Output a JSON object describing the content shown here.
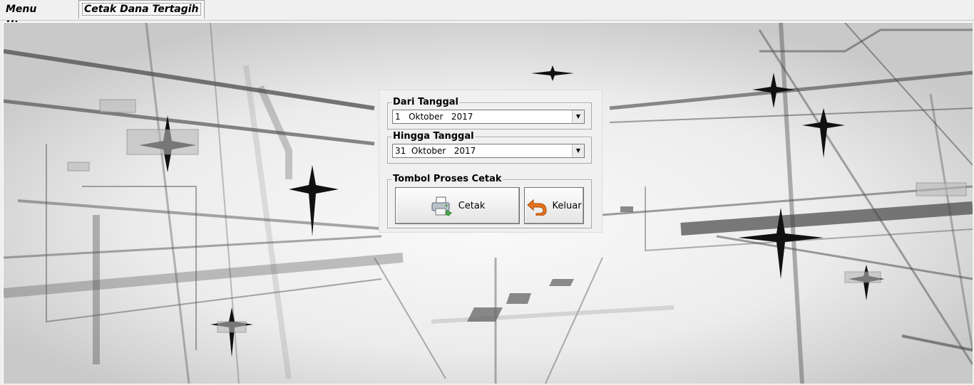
{
  "tabs": [
    {
      "label": "Menu Utama",
      "active": false
    },
    {
      "label": "Cetak Dana Tertagih",
      "active": true
    }
  ],
  "form": {
    "dari_tanggal": {
      "legend": "Dari Tanggal",
      "value": "1   Oktober   2017"
    },
    "hingga_tanggal": {
      "legend": "Hingga Tanggal",
      "value": "31  Oktober   2017"
    },
    "tombol": {
      "legend": "Tombol Proses Cetak",
      "cetak_label": "Cetak",
      "keluar_label": "Keluar"
    }
  },
  "icons": {
    "dropdown": "chevron-down-icon",
    "cetak": "printer-icon",
    "keluar": "back-arrow-icon"
  },
  "colors": {
    "window_bg": "#f0f0f0",
    "keluar_icon": "#e8731c"
  }
}
